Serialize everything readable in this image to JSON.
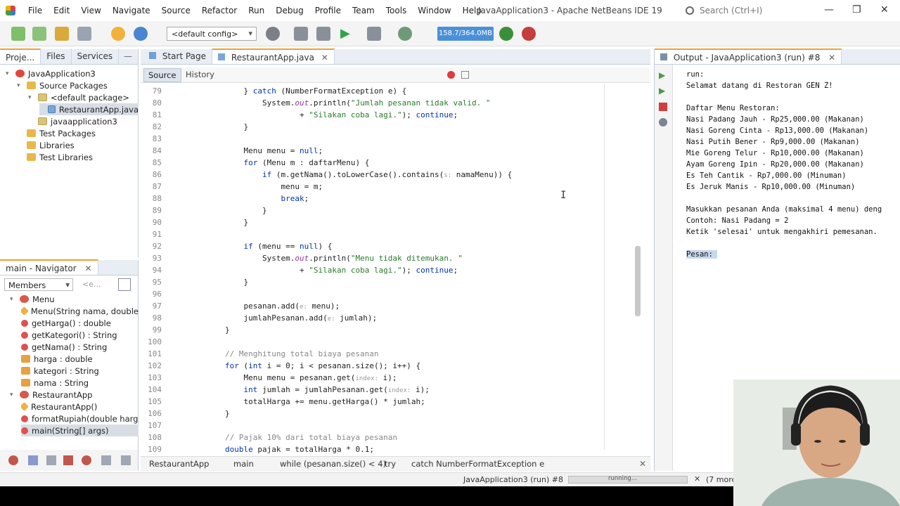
{
  "window": {
    "title": "JavaApplication3 - Apache NetBeans IDE 19",
    "menus": [
      "File",
      "Edit",
      "View",
      "Navigate",
      "Source",
      "Refactor",
      "Run",
      "Debug",
      "Profile",
      "Team",
      "Tools",
      "Window",
      "Help"
    ],
    "search_placeholder": "Search (Ctrl+I)"
  },
  "toolbar": {
    "config": "<default config>",
    "memory": "158.7/364.0MB"
  },
  "projects_panel": {
    "tabs": [
      "Proje...",
      "Files",
      "Services"
    ],
    "tree": [
      {
        "label": "JavaApplication3",
        "type": "proj"
      },
      {
        "label": "Source Packages",
        "type": "folder"
      },
      {
        "label": "<default package>",
        "type": "pkg"
      },
      {
        "label": "RestaurantApp.java",
        "type": "java"
      },
      {
        "label": "javaapplication3",
        "type": "pkg"
      },
      {
        "label": "Test Packages",
        "type": "folder"
      },
      {
        "label": "Libraries",
        "type": "folder"
      },
      {
        "label": "Test Libraries",
        "type": "folder"
      }
    ]
  },
  "navigator": {
    "title": "main - Navigator",
    "filter": "Members",
    "filter2": "<e...",
    "items": [
      {
        "label": "Menu",
        "type": "class"
      },
      {
        "label": "Menu(String nama, double",
        "type": "ctor"
      },
      {
        "label": "getHarga() : double",
        "type": "meth"
      },
      {
        "label": "getKategori() : String",
        "type": "meth"
      },
      {
        "label": "getNama() : String",
        "type": "meth"
      },
      {
        "label": "harga : double",
        "type": "field"
      },
      {
        "label": "kategori : String",
        "type": "field"
      },
      {
        "label": "nama : String",
        "type": "field"
      },
      {
        "label": "RestaurantApp",
        "type": "class"
      },
      {
        "label": "RestaurantApp()",
        "type": "ctor"
      },
      {
        "label": "formatRupiah(double harg",
        "type": "meth"
      },
      {
        "label": "main(String[] args)",
        "type": "meth"
      }
    ]
  },
  "editor": {
    "tabs": [
      "Start Page",
      "RestaurantApp.java"
    ],
    "subtabs": [
      "Source",
      "History"
    ],
    "lines": [
      {
        "n": "79",
        "html": "    } <span class='kw'>catch</span> (NumberFormatException e) {"
      },
      {
        "n": "80",
        "html": "        System.<span class='fld'>out</span>.println(<span class='str'>\"Jumlah pesanan tidak valid. \"</span>"
      },
      {
        "n": "81",
        "html": "                + <span class='str'>\"Silakan coba lagi.\"</span>); <span class='kw'>continue</span>;"
      },
      {
        "n": "82",
        "html": "    }"
      },
      {
        "n": "83",
        "html": ""
      },
      {
        "n": "84",
        "html": "    Menu menu = <span class='kw'>null</span>;"
      },
      {
        "n": "85",
        "html": "    <span class='kw'>for</span> (Menu m : daftarMenu) {"
      },
      {
        "n": "86",
        "html": "        <span class='kw'>if</span> (m.getNama().toLowerCase().contains(<span class='hint'>s:</span> namaMenu)) {"
      },
      {
        "n": "87",
        "html": "            menu = m;"
      },
      {
        "n": "88",
        "html": "            <span class='kw'>break</span>;"
      },
      {
        "n": "89",
        "html": "        }"
      },
      {
        "n": "90",
        "html": "    }"
      },
      {
        "n": "91",
        "html": ""
      },
      {
        "n": "92",
        "html": "    <span class='kw'>if</span> (menu == <span class='kw'>null</span>) {"
      },
      {
        "n": "93",
        "html": "        System.<span class='fld'>out</span>.println(<span class='str'>\"Menu tidak ditemukan. \"</span>"
      },
      {
        "n": "94",
        "html": "                + <span class='str'>\"Silakan coba lagi.\"</span>); <span class='kw'>continue</span>;"
      },
      {
        "n": "95",
        "html": "    }"
      },
      {
        "n": "96",
        "html": ""
      },
      {
        "n": "97",
        "html": "    pesanan.add(<span class='hint'>e:</span> menu);"
      },
      {
        "n": "98",
        "html": "    jumlahPesanan.add(<span class='hint'>e:</span> jumlah);"
      },
      {
        "n": "99",
        "html": "}"
      },
      {
        "n": "100",
        "html": ""
      },
      {
        "n": "101",
        "html": "<span class='cmt'>// Menghitung total biaya pesanan</span>"
      },
      {
        "n": "102",
        "html": "<span class='kw'>for</span> (<span class='kw'>int</span> i = 0; i &lt; pesanan.size(); i++) {"
      },
      {
        "n": "103",
        "html": "    Menu menu = pesanan.get(<span class='hint'>index:</span> i);"
      },
      {
        "n": "104",
        "html": "    <span class='kw'>int</span> jumlah = jumlahPesanan.get(<span class='hint'>index:</span> i);"
      },
      {
        "n": "105",
        "html": "    totalHarga += menu.getHarga() * jumlah;"
      },
      {
        "n": "106",
        "html": "}"
      },
      {
        "n": "107",
        "html": ""
      },
      {
        "n": "108",
        "html": "<span class='cmt'>// Pajak 10% dari total biaya pesanan</span>"
      },
      {
        "n": "109",
        "html": "<span class='kw'>double</span> pajak = totalHarga * 0.1;"
      }
    ],
    "breadcrumbs": [
      "RestaurantApp",
      "main",
      "while (pesanan.size() < 4)",
      "try",
      "catch NumberFormatException e"
    ]
  },
  "output": {
    "title": "Output - JavaApplication3 (run) #8",
    "lines": [
      "run:",
      "Selamat datang di Restoran GEN Z!",
      "",
      "Daftar Menu Restoran:",
      "Nasi Padang Jauh - Rp25,000.00 (Makanan)",
      "Nasi Goreng Cinta - Rp13,000.00 (Makanan)",
      "Nasi Putih Bener - Rp9,000.00 (Makanan)",
      "Mie Goreng Telur - Rp10,000.00 (Makanan)",
      "Ayam Goreng Ipin - Rp20,000.00 (Makanan)",
      "Es Teh Cantik - Rp7,000.00 (Minuman)",
      "Es Jeruk Manis - Rp10,000.00 (Minuman)",
      "",
      "Masukkan pesanan Anda (maksimal 4 menu) deng",
      "Contoh: Nasi Padang = 2",
      "Ketik 'selesai' untuk mengakhiri pemesanan.",
      "",
      "Pesan: "
    ]
  },
  "status": {
    "task": "JavaApplication3 (run) #8",
    "progress_text": "running...",
    "more": "(7 more..."
  }
}
